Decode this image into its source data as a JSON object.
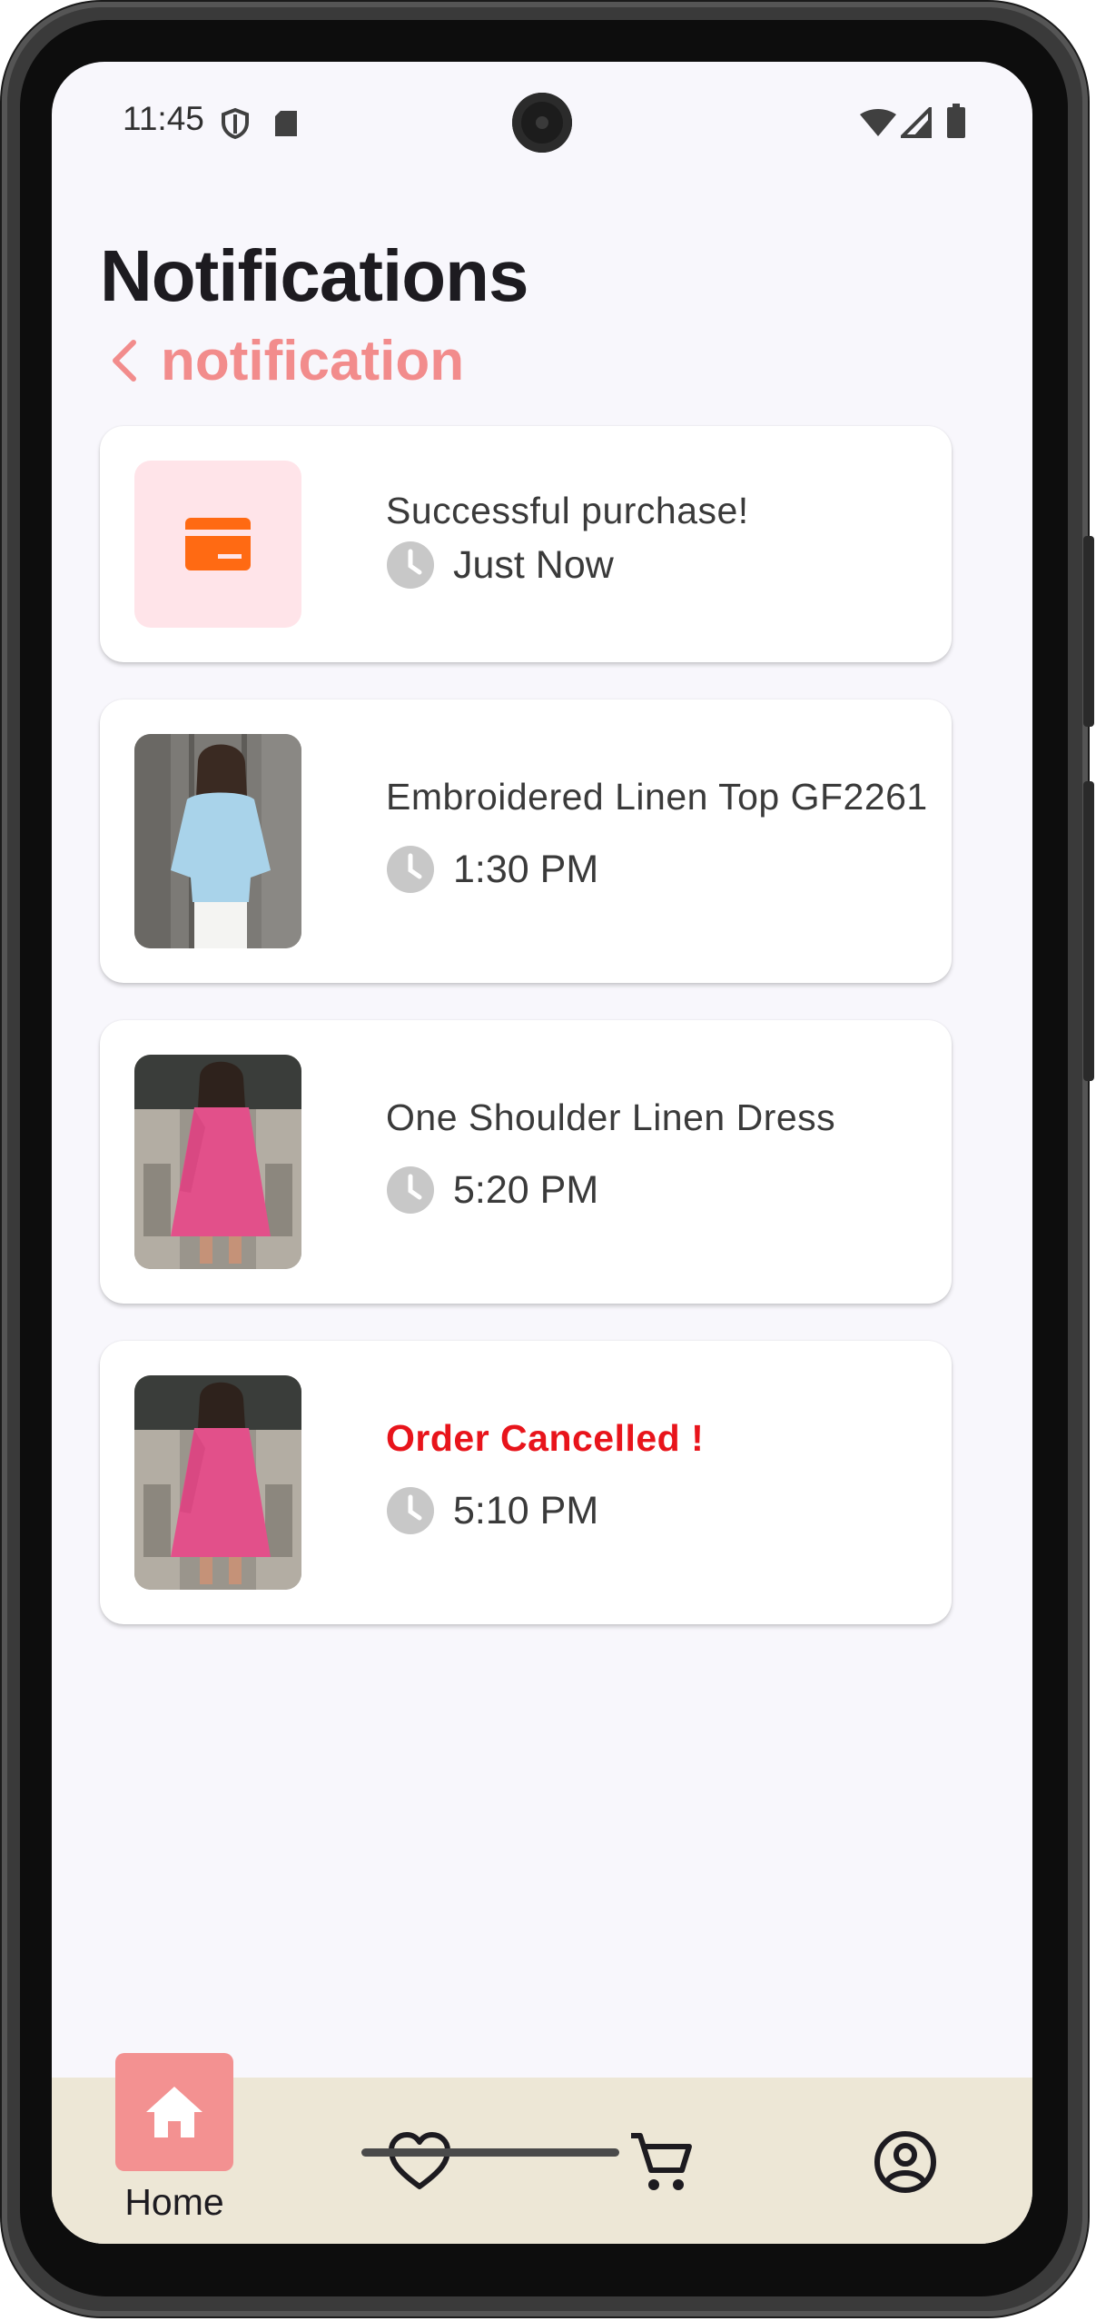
{
  "status_bar": {
    "time": "11:45",
    "icons": [
      "shield-icon",
      "sd-card-icon",
      "wifi-icon",
      "signal-icon",
      "battery-icon"
    ]
  },
  "header": {
    "title": "Notifications",
    "back_label": "notification"
  },
  "notifications": [
    {
      "title": "Successful purchase!",
      "time": "Just Now",
      "icon": "credit-card-icon"
    },
    {
      "title": "Embroidered Linen Top GF2261",
      "time": "1:30 PM",
      "icon": "product-thumbnail-blue-top"
    },
    {
      "title": "One Shoulder Linen Dress",
      "time": "5:20 PM",
      "icon": "product-thumbnail-pink-dress"
    },
    {
      "title": "Order Cancelled !",
      "time": "5:10 PM",
      "icon": "product-thumbnail-pink-dress"
    }
  ],
  "bottom_nav": {
    "home_label": "Home",
    "items": [
      "home-icon",
      "heart-icon",
      "cart-icon",
      "account-icon"
    ]
  },
  "colors": {
    "accent": "#f39191",
    "alert": "#e8141b",
    "nav_background": "#ede7d6",
    "card_icon_bg": "#ffe4e9",
    "card_icon": "#ff6a13"
  }
}
